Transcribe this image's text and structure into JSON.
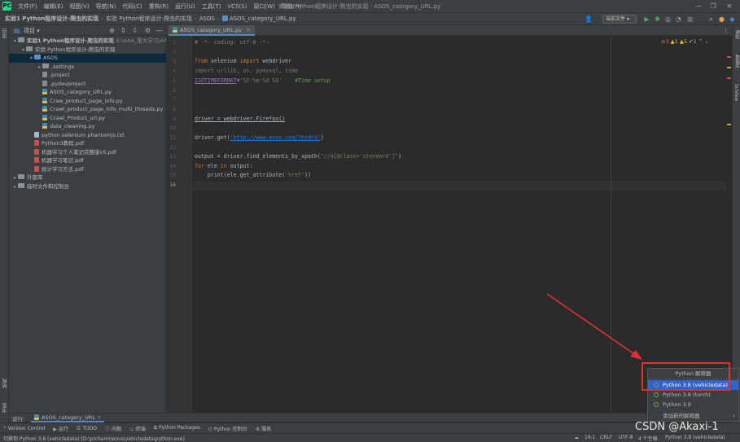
{
  "menubar": {
    "items": [
      "文件(F)",
      "编辑(E)",
      "视图(V)",
      "导航(N)",
      "代码(C)",
      "重构(R)",
      "运行(U)",
      "工具(T)",
      "VCS(S)",
      "窗口(W)",
      "帮助(H)"
    ],
    "window_title": "实验1 Python程序设计-爬虫的实现 - ASOS_category_URL.py"
  },
  "navbar": {
    "crumbs": [
      "实验1 Python程序设计-爬虫的实现",
      "实验 Python程序设计-爬虫的实现",
      "ASOS",
      "ASOS_category_URL.py"
    ],
    "run_config": "当前文件"
  },
  "project": {
    "header": "项目",
    "root_path": "E:\\AAA_重大学习\\AAA",
    "tree": [
      {
        "label": "实验1 Python程序设计-爬虫的实现",
        "depth": 0,
        "kind": "folder",
        "open": true,
        "bold": true
      },
      {
        "label": "实验 Python程序设计-爬虫的实现",
        "depth": 1,
        "kind": "folder",
        "open": true
      },
      {
        "label": "ASOS",
        "depth": 2,
        "kind": "folder-blue",
        "open": true,
        "selected": true
      },
      {
        "label": ".settings",
        "depth": 3,
        "kind": "folder",
        "open": false
      },
      {
        "label": ".project",
        "depth": 3,
        "kind": "gen"
      },
      {
        "label": ".pydevproject",
        "depth": 3,
        "kind": "gen"
      },
      {
        "label": "ASOS_category_URL.py",
        "depth": 3,
        "kind": "py"
      },
      {
        "label": "Craw_product_page_info.py",
        "depth": 3,
        "kind": "py"
      },
      {
        "label": "Crawl_product_page_info_multi_threads.py",
        "depth": 3,
        "kind": "py"
      },
      {
        "label": "Crawl_Product_url.py",
        "depth": 3,
        "kind": "py"
      },
      {
        "label": "data_cleaning.py",
        "depth": 3,
        "kind": "py"
      },
      {
        "label": "python selenium phantomjs.txt",
        "depth": 2,
        "kind": "txt"
      },
      {
        "label": "Python3教程.pdf",
        "depth": 2,
        "kind": "pdf"
      },
      {
        "label": "机器学习个人笔记完整版v5.pdf",
        "depth": 2,
        "kind": "pdf"
      },
      {
        "label": "机器学习笔记.pdf",
        "depth": 2,
        "kind": "pdf"
      },
      {
        "label": "统计学习方法.pdf",
        "depth": 2,
        "kind": "pdf"
      },
      {
        "label": "外部库",
        "depth": 0,
        "kind": "lib",
        "open": false
      },
      {
        "label": "临时文件和控制台",
        "depth": 0,
        "kind": "scratch",
        "open": false
      }
    ]
  },
  "editor": {
    "tab_label": "ASOS_category_URL.py",
    "line_numbers": [
      "1",
      "2",
      "3",
      "4",
      "5",
      "6",
      "7",
      "8",
      "9",
      "10",
      "11",
      "12",
      "13",
      "14",
      "15",
      "16"
    ],
    "current_line": "16",
    "inspections": {
      "errors": "3",
      "warnings": "1",
      "weak": "5",
      "ok": "1"
    },
    "code": {
      "l1": "# -*- coding: utf-8 -*-",
      "l3_kw1": "from",
      "l3_mod": " selenium ",
      "l3_kw2": "import",
      "l3_name": " webdriver",
      "l4": "import urllib, os, pymysql, time",
      "l5_const": "ISOTIMEFORMAT",
      "l5_eq": "=",
      "l5_str": "'%Y-%m-%d %X'",
      "l5_comment": "    #Time setup",
      "l9": "driver = webdriver.Firefox()",
      "l11_pre": "driver.get(",
      "l11_url": "'http://www.asos.com/?hrd=1'",
      "l11_post": ")",
      "l13_pre": "output = driver.find_elements_by_xpath(",
      "l13_str": "\"//a[@class='standard']\"",
      "l13_post": ")",
      "l14_kw1": "for",
      "l14_mid": " ele ",
      "l14_kw2": "in",
      "l14_post": " output:",
      "l15_pre": "    print(ele.get_attribute(",
      "l15_str": "'href'",
      "l15_post": "))"
    }
  },
  "left_strip": {
    "project_tab": "项目",
    "structure_tab": "结构",
    "bookmarks_tab": "书签"
  },
  "right_strip": {
    "notifications_tab": "通知",
    "database_tab": "数据库",
    "sciview_tab": "SciView"
  },
  "run_bar": {
    "label": "运行:",
    "tab": "ASOS_category_URL"
  },
  "tool_tabs": [
    "Version Control",
    "运行",
    "TODO",
    "问题",
    "终端",
    "Python Packages",
    "Python 控制台",
    "服务"
  ],
  "status": {
    "message": "切换到 Python 3.8 (vehicledata) [D:\\prcharm\\envs\\vehicledata\\python.exe]",
    "position": "16:1",
    "line_sep": "CRLF",
    "encoding": "UTF-8",
    "indent": "4 个空格",
    "interpreter": "Python 3.8 (vehicledata)"
  },
  "interpreter_popup": {
    "title": "Python 解释器",
    "items": [
      "Python 3.8 (vehicledata)",
      "Python 3.8 (torch)",
      "Python 3.9"
    ],
    "add": "添加新的解释器",
    "selected_index": 0
  },
  "watermark": "CSDN @Akaxi-1",
  "colors": {
    "accent": "#4a88c7",
    "annotation_red": "#e03030",
    "selection": "#2f65ca"
  }
}
